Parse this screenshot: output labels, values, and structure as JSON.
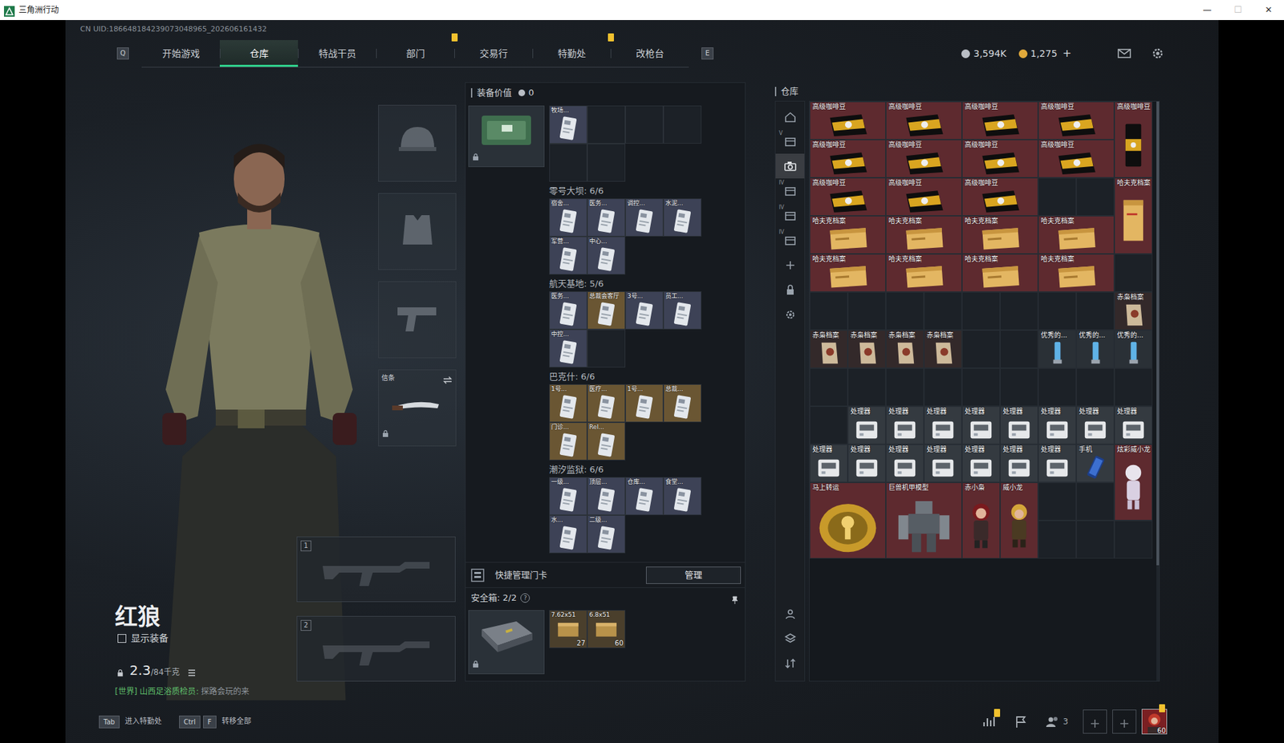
{
  "window": {
    "title": "三角洲行动",
    "controls": [
      "—",
      "☐",
      "✕"
    ]
  },
  "uid": "CN UID:186648184239073048965_202606161432",
  "nav": {
    "prev_key": "Q",
    "next_key": "E",
    "tabs": [
      {
        "label": "开始游戏",
        "selected": false,
        "alert": false
      },
      {
        "label": "仓库",
        "selected": true,
        "alert": false
      },
      {
        "label": "特战干员",
        "selected": false,
        "alert": false
      },
      {
        "label": "部门",
        "selected": false,
        "alert": true
      },
      {
        "label": "交易行",
        "selected": false,
        "alert": false
      },
      {
        "label": "特勤处",
        "selected": false,
        "alert": true
      },
      {
        "label": "改枪台",
        "selected": false,
        "alert": false
      }
    ]
  },
  "currency": {
    "items": [
      {
        "amount": "3,594K",
        "color": "#b9bec5"
      },
      {
        "amount": "1,275",
        "color": "#e0a93b"
      }
    ],
    "topup": "+"
  },
  "operator": {
    "name": "红狼",
    "show_gear": {
      "label": "显示装备",
      "checked": false
    },
    "weight": "2.3",
    "weight_max": "/84千克",
    "chat": {
      "channel": "[世界]",
      "sender": "山西足浴质检员:",
      "message": "探路会玩的来"
    }
  },
  "equipment": [
    {
      "kind": "helmet",
      "locked": false
    },
    {
      "kind": "armor",
      "locked": false
    },
    {
      "kind": "pistol",
      "locked": false
    },
    {
      "kind": "melee",
      "label": "信条",
      "locked": true
    }
  ],
  "weapon_slots": [
    {
      "number": "1"
    },
    {
      "number": "2"
    }
  ],
  "loadout": {
    "value_label": "装备价值",
    "value": "0",
    "holder_locked": true,
    "top_slots": [
      {
        "kind": "card",
        "label": "牧场...",
        "color": "#3d4256"
      },
      {
        "kind": "empty"
      },
      {
        "kind": "empty"
      },
      {
        "kind": "empty"
      },
      {
        "kind": "empty"
      },
      {
        "kind": "empty"
      }
    ],
    "sections": [
      {
        "title": "零号大坝: 6/6",
        "slots": [
          {
            "kind": "card",
            "label": "宿舍...",
            "color": "#3d4256"
          },
          {
            "kind": "card",
            "label": "医务...",
            "color": "#3d4256"
          },
          {
            "kind": "card",
            "label": "调控...",
            "color": "#3d4256"
          },
          {
            "kind": "card",
            "label": "水泥...",
            "color": "#3d4256"
          },
          {
            "kind": "card",
            "label": "军营...",
            "color": "#3d4256"
          },
          {
            "kind": "card",
            "label": "中心...",
            "color": "#3d4256"
          }
        ]
      },
      {
        "title": "航天基地: 5/6",
        "slots": [
          {
            "kind": "card",
            "label": "医务...",
            "color": "#3d4256"
          },
          {
            "kind": "card",
            "label": "总裁会客厅",
            "color": "#6a5633"
          },
          {
            "kind": "card",
            "label": "3号...",
            "color": "#3d4256"
          },
          {
            "kind": "card",
            "label": "员工...",
            "color": "#3d4256"
          },
          {
            "kind": "card",
            "label": "中控...",
            "color": "#3d4256"
          },
          {
            "kind": "empty"
          }
        ]
      },
      {
        "title": "巴克什: 6/6",
        "slots": [
          {
            "kind": "card",
            "label": "1号...",
            "color": "#6a5633"
          },
          {
            "kind": "card",
            "label": "医疗...",
            "color": "#6a5633"
          },
          {
            "kind": "card",
            "label": "1号...",
            "color": "#6a5633"
          },
          {
            "kind": "card",
            "label": "总裁...",
            "color": "#6a5633"
          },
          {
            "kind": "card",
            "label": "门诊...",
            "color": "#6a5633"
          },
          {
            "kind": "card",
            "label": "Rel...",
            "color": "#6a5633"
          }
        ]
      },
      {
        "title": "潮汐监狱: 6/6",
        "slots": [
          {
            "kind": "card",
            "label": "一级...",
            "color": "#3d4256"
          },
          {
            "kind": "card",
            "label": "顶层...",
            "color": "#3d4256"
          },
          {
            "kind": "card",
            "label": "仓库...",
            "color": "#3d4256"
          },
          {
            "kind": "card",
            "label": "食堂...",
            "color": "#3d4256"
          },
          {
            "kind": "card",
            "label": "水...",
            "color": "#3d4256"
          },
          {
            "kind": "card",
            "label": "二级...",
            "color": "#3d4256"
          }
        ]
      }
    ]
  },
  "quick_cards": {
    "label": "快捷管理门卡",
    "button": "管理"
  },
  "safebox": {
    "title": "安全箱: 2/2",
    "help": "?",
    "locked": true,
    "items": [
      {
        "label": "7.62x51",
        "count": "27"
      },
      {
        "label": "6.8x51",
        "count": "60"
      }
    ]
  },
  "warehouse": {
    "title": "仓库",
    "sidebar": [
      {
        "kind": "home",
        "selected": false
      },
      {
        "kind": "stash",
        "label": "V",
        "selected": false
      },
      {
        "kind": "camera",
        "selected": true
      },
      {
        "kind": "stash",
        "label": "IV",
        "selected": false
      },
      {
        "kind": "stash",
        "label": "IV",
        "selected": false
      },
      {
        "kind": "stash",
        "label": "IV",
        "selected": false
      },
      {
        "kind": "add",
        "selected": false
      },
      {
        "kind": "lock",
        "selected": false
      },
      {
        "kind": "settings",
        "selected": false
      }
    ],
    "sidebar_bottom": [
      {
        "kind": "person",
        "selected": false
      },
      {
        "kind": "layers",
        "selected": false
      },
      {
        "kind": "sort",
        "selected": false
      }
    ],
    "items": [
      {
        "kind": "coffeebag",
        "label": "高级咖啡豆",
        "color": "#5e2a2f"
      },
      {
        "kind": "coffeebag",
        "label": "高级咖啡豆",
        "color": "#5e2a2f"
      },
      {
        "kind": "coffeebag",
        "label": "高级咖啡豆",
        "color": "#5e2a2f"
      },
      {
        "kind": "coffeebag",
        "label": "高级咖啡豆",
        "color": "#5e2a2f"
      },
      {
        "kind": "coffeebagtall",
        "label": "高级咖啡豆",
        "color": "#5e2a2f"
      },
      {
        "kind": "coffeebag",
        "label": "高级咖啡豆",
        "color": "#5e2a2f"
      },
      {
        "kind": "coffeebag",
        "label": "高级咖啡豆",
        "color": "#5e2a2f"
      },
      {
        "kind": "coffeebag",
        "label": "高级咖啡豆",
        "color": "#5e2a2f"
      },
      {
        "kind": "coffeebag",
        "label": "高级咖啡豆",
        "color": "#5e2a2f"
      },
      {
        "kind": "coffeebag",
        "label": "高级咖啡豆",
        "color": "#5e2a2f"
      },
      {
        "kind": "coffeebag",
        "label": "高级咖啡豆",
        "color": "#5e2a2f"
      },
      {
        "kind": "coffeebag",
        "label": "高级咖啡豆",
        "color": "#5e2a2f"
      },
      {
        "kind": "empty"
      },
      {
        "kind": "empty"
      },
      {
        "kind": "foldertall",
        "label": "哈夫克档案",
        "color": "#5e2a2f"
      },
      {
        "kind": "folder",
        "label": "哈夫克档案",
        "color": "#5e2a2f"
      },
      {
        "kind": "folder",
        "label": "哈夫克档案",
        "color": "#5e2a2f"
      },
      {
        "kind": "folder",
        "label": "哈夫克档案",
        "color": "#5e2a2f"
      },
      {
        "kind": "folder",
        "label": "哈夫克档案",
        "color": "#5e2a2f"
      },
      {
        "kind": "folder",
        "label": "哈夫克档案",
        "color": "#5e2a2f"
      },
      {
        "kind": "folder",
        "label": "哈夫克档案",
        "color": "#5e2a2f"
      },
      {
        "kind": "folder",
        "label": "哈夫克档案",
        "color": "#5e2a2f"
      },
      {
        "kind": "folder",
        "label": "哈夫克档案",
        "color": "#5e2a2f"
      },
      {
        "kind": "empty"
      },
      {
        "kind": "empty"
      },
      {
        "kind": "empty"
      },
      {
        "kind": "empty"
      },
      {
        "kind": "empty"
      },
      {
        "kind": "empty"
      },
      {
        "kind": "empty"
      },
      {
        "kind": "empty"
      },
      {
        "kind": "empty"
      },
      {
        "kind": "dossier",
        "label": "赤枭档案",
        "color": "#33292a"
      },
      {
        "kind": "dossier",
        "label": "赤枭档案",
        "color": "#33292a"
      },
      {
        "kind": "dossier",
        "label": "赤枭档案",
        "color": "#33292a"
      },
      {
        "kind": "dossier",
        "label": "赤枭档案",
        "color": "#33292a"
      },
      {
        "kind": "dossier",
        "label": "赤枭档案",
        "color": "#33292a"
      },
      {
        "kind": "empty"
      },
      {
        "kind": "empty"
      },
      {
        "kind": "crystal",
        "label": "优秀的...",
        "color": "#2a3036"
      },
      {
        "kind": "crystal",
        "label": "优秀的...",
        "color": "#2a3036"
      },
      {
        "kind": "crystal",
        "label": "优秀的...",
        "color": "#2a3036"
      },
      {
        "kind": "empty"
      },
      {
        "kind": "empty"
      },
      {
        "kind": "empty"
      },
      {
        "kind": "empty"
      },
      {
        "kind": "empty"
      },
      {
        "kind": "empty"
      },
      {
        "kind": "empty"
      },
      {
        "kind": "empty"
      },
      {
        "kind": "empty"
      },
      {
        "kind": "empty"
      },
      {
        "kind": "chip",
        "label": "处理器",
        "color": "#343a40"
      },
      {
        "kind": "chip",
        "label": "处理器",
        "color": "#343a40"
      },
      {
        "kind": "chip",
        "label": "处理器",
        "color": "#343a40"
      },
      {
        "kind": "chip",
        "label": "处理器",
        "color": "#343a40"
      },
      {
        "kind": "chip",
        "label": "处理器",
        "color": "#343a40"
      },
      {
        "kind": "chip",
        "label": "处理器",
        "color": "#343a40"
      },
      {
        "kind": "chip",
        "label": "处理器",
        "color": "#343a40"
      },
      {
        "kind": "chip",
        "label": "处理器",
        "color": "#343a40"
      },
      {
        "kind": "chip",
        "label": "处理器",
        "color": "#343a40"
      },
      {
        "kind": "chip",
        "label": "处理器",
        "color": "#343a40"
      },
      {
        "kind": "chip",
        "label": "处理器",
        "color": "#343a40"
      },
      {
        "kind": "chip",
        "label": "处理器",
        "color": "#343a40"
      },
      {
        "kind": "chip",
        "label": "处理器",
        "color": "#343a40"
      },
      {
        "kind": "chip",
        "label": "处理器",
        "color": "#343a40"
      },
      {
        "kind": "chip",
        "label": "处理器",
        "color": "#343a40"
      },
      {
        "kind": "phone",
        "label": "手机",
        "color": "#343a40"
      },
      {
        "kind": "figuretall",
        "label": "炫彩威小龙",
        "color": "#5e2a2f"
      },
      {
        "kind": "medal",
        "label": "马上转运",
        "color": "#5e2a2f"
      },
      {
        "kind": "mech",
        "label": "巨兽机甲模型",
        "color": "#5e2a2f"
      },
      {
        "kind": "redfigure",
        "label": "赤小枭",
        "color": "#5e2a2f"
      },
      {
        "kind": "goldfigure",
        "label": "威小龙",
        "color": "#5e2a2f"
      },
      {
        "kind": "empty"
      },
      {
        "kind": "empty"
      },
      {
        "kind": "empty"
      },
      {
        "kind": "empty"
      },
      {
        "kind": "empty"
      }
    ]
  },
  "bottom_bar": {
    "hints": [
      {
        "keys": [
          "Tab"
        ],
        "label": "进入特勤处"
      },
      {
        "keys": [
          "Ctrl",
          "F"
        ],
        "label": "转移全部"
      }
    ],
    "stats_alert": true,
    "friends": "3",
    "level": "60",
    "avatar_alert": true
  }
}
